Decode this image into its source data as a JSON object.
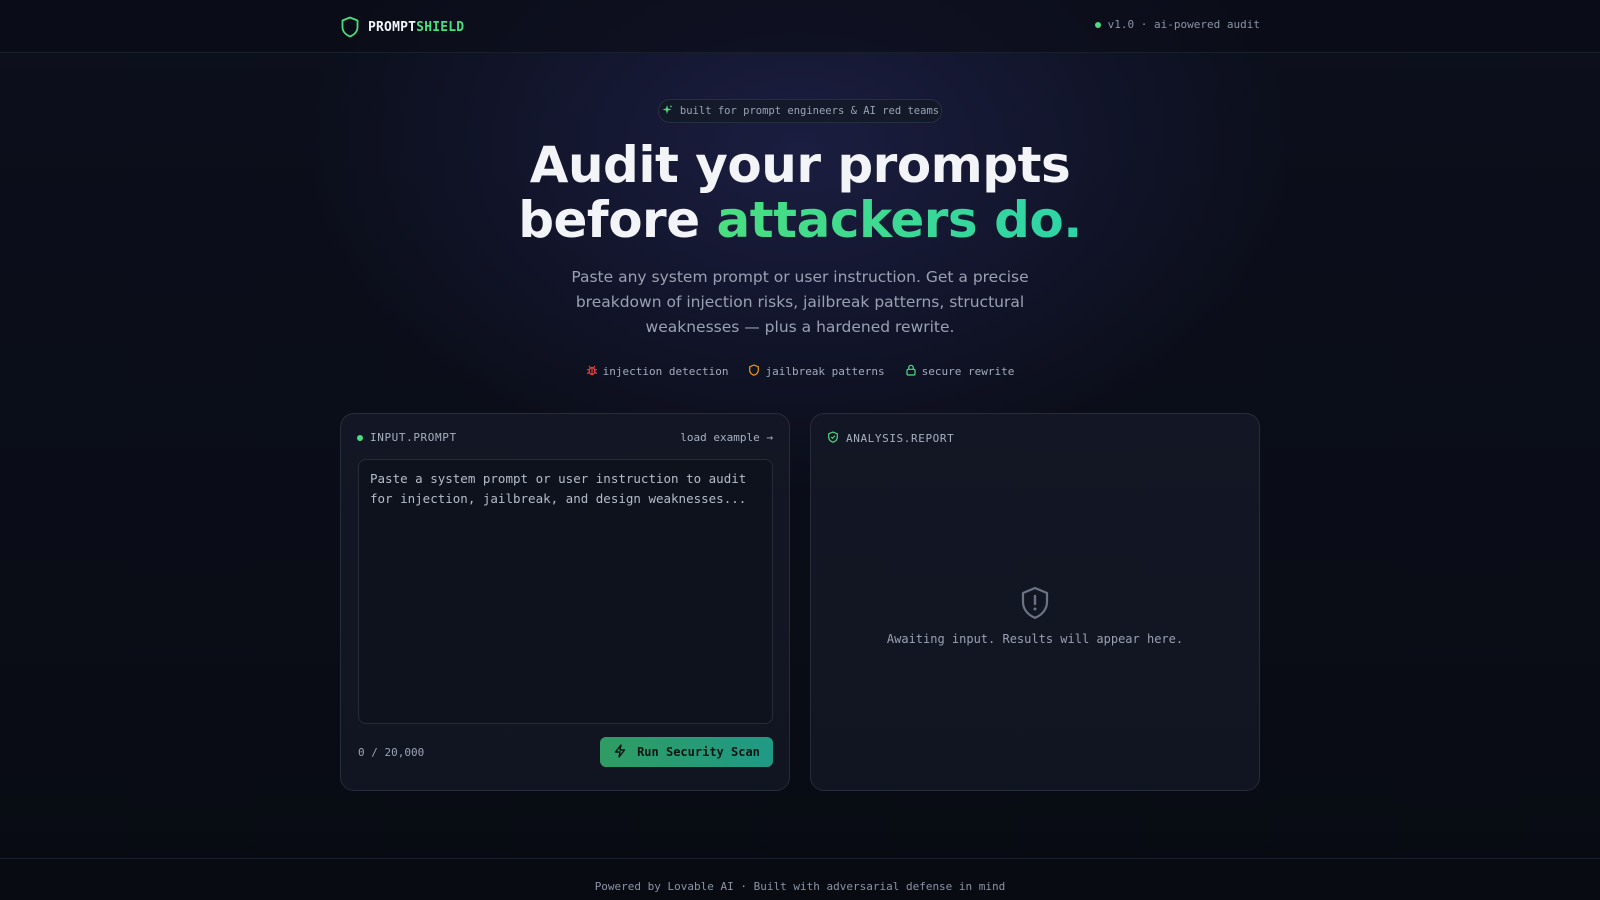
{
  "header": {
    "brand_prefix": "PROMPT",
    "brand_suffix": "SHIELD",
    "version": "v1.0 · ai-powered audit"
  },
  "hero": {
    "badge": "built for prompt engineers & AI red teams",
    "headline_line1": "Audit your prompts",
    "headline_line2_lead": "before ",
    "headline_line2_accent": "attackers do.",
    "subtitle": "Paste any system prompt or user instruction. Get a precise breakdown of injection risks, jailbreak patterns, structural weaknesses — plus a hardened rewrite.",
    "features": [
      {
        "label": "injection detection",
        "icon": "bug-icon",
        "color": "#ef4444"
      },
      {
        "label": "jailbreak patterns",
        "icon": "shield-icon",
        "color": "#f59e0b"
      },
      {
        "label": "secure rewrite",
        "icon": "lock-icon",
        "color": "#4ade80"
      }
    ]
  },
  "input_panel": {
    "title": "INPUT.PROMPT",
    "load_example": "load example →",
    "placeholder": "Paste a system prompt or user instruction to audit for injection, jailbreak, and design weaknesses...",
    "value": "",
    "counter": "0 / 20,000",
    "scan_button": "Run Security Scan"
  },
  "report_panel": {
    "title": "ANALYSIS.REPORT",
    "empty_message": "Awaiting input. Results will appear here."
  },
  "footer": {
    "text": "Powered by Lovable AI · Built with adversarial defense in mind"
  },
  "colors": {
    "accent_green": "#4ade80",
    "accent_teal": "#2dd4a8",
    "background": "#0a0d16"
  }
}
